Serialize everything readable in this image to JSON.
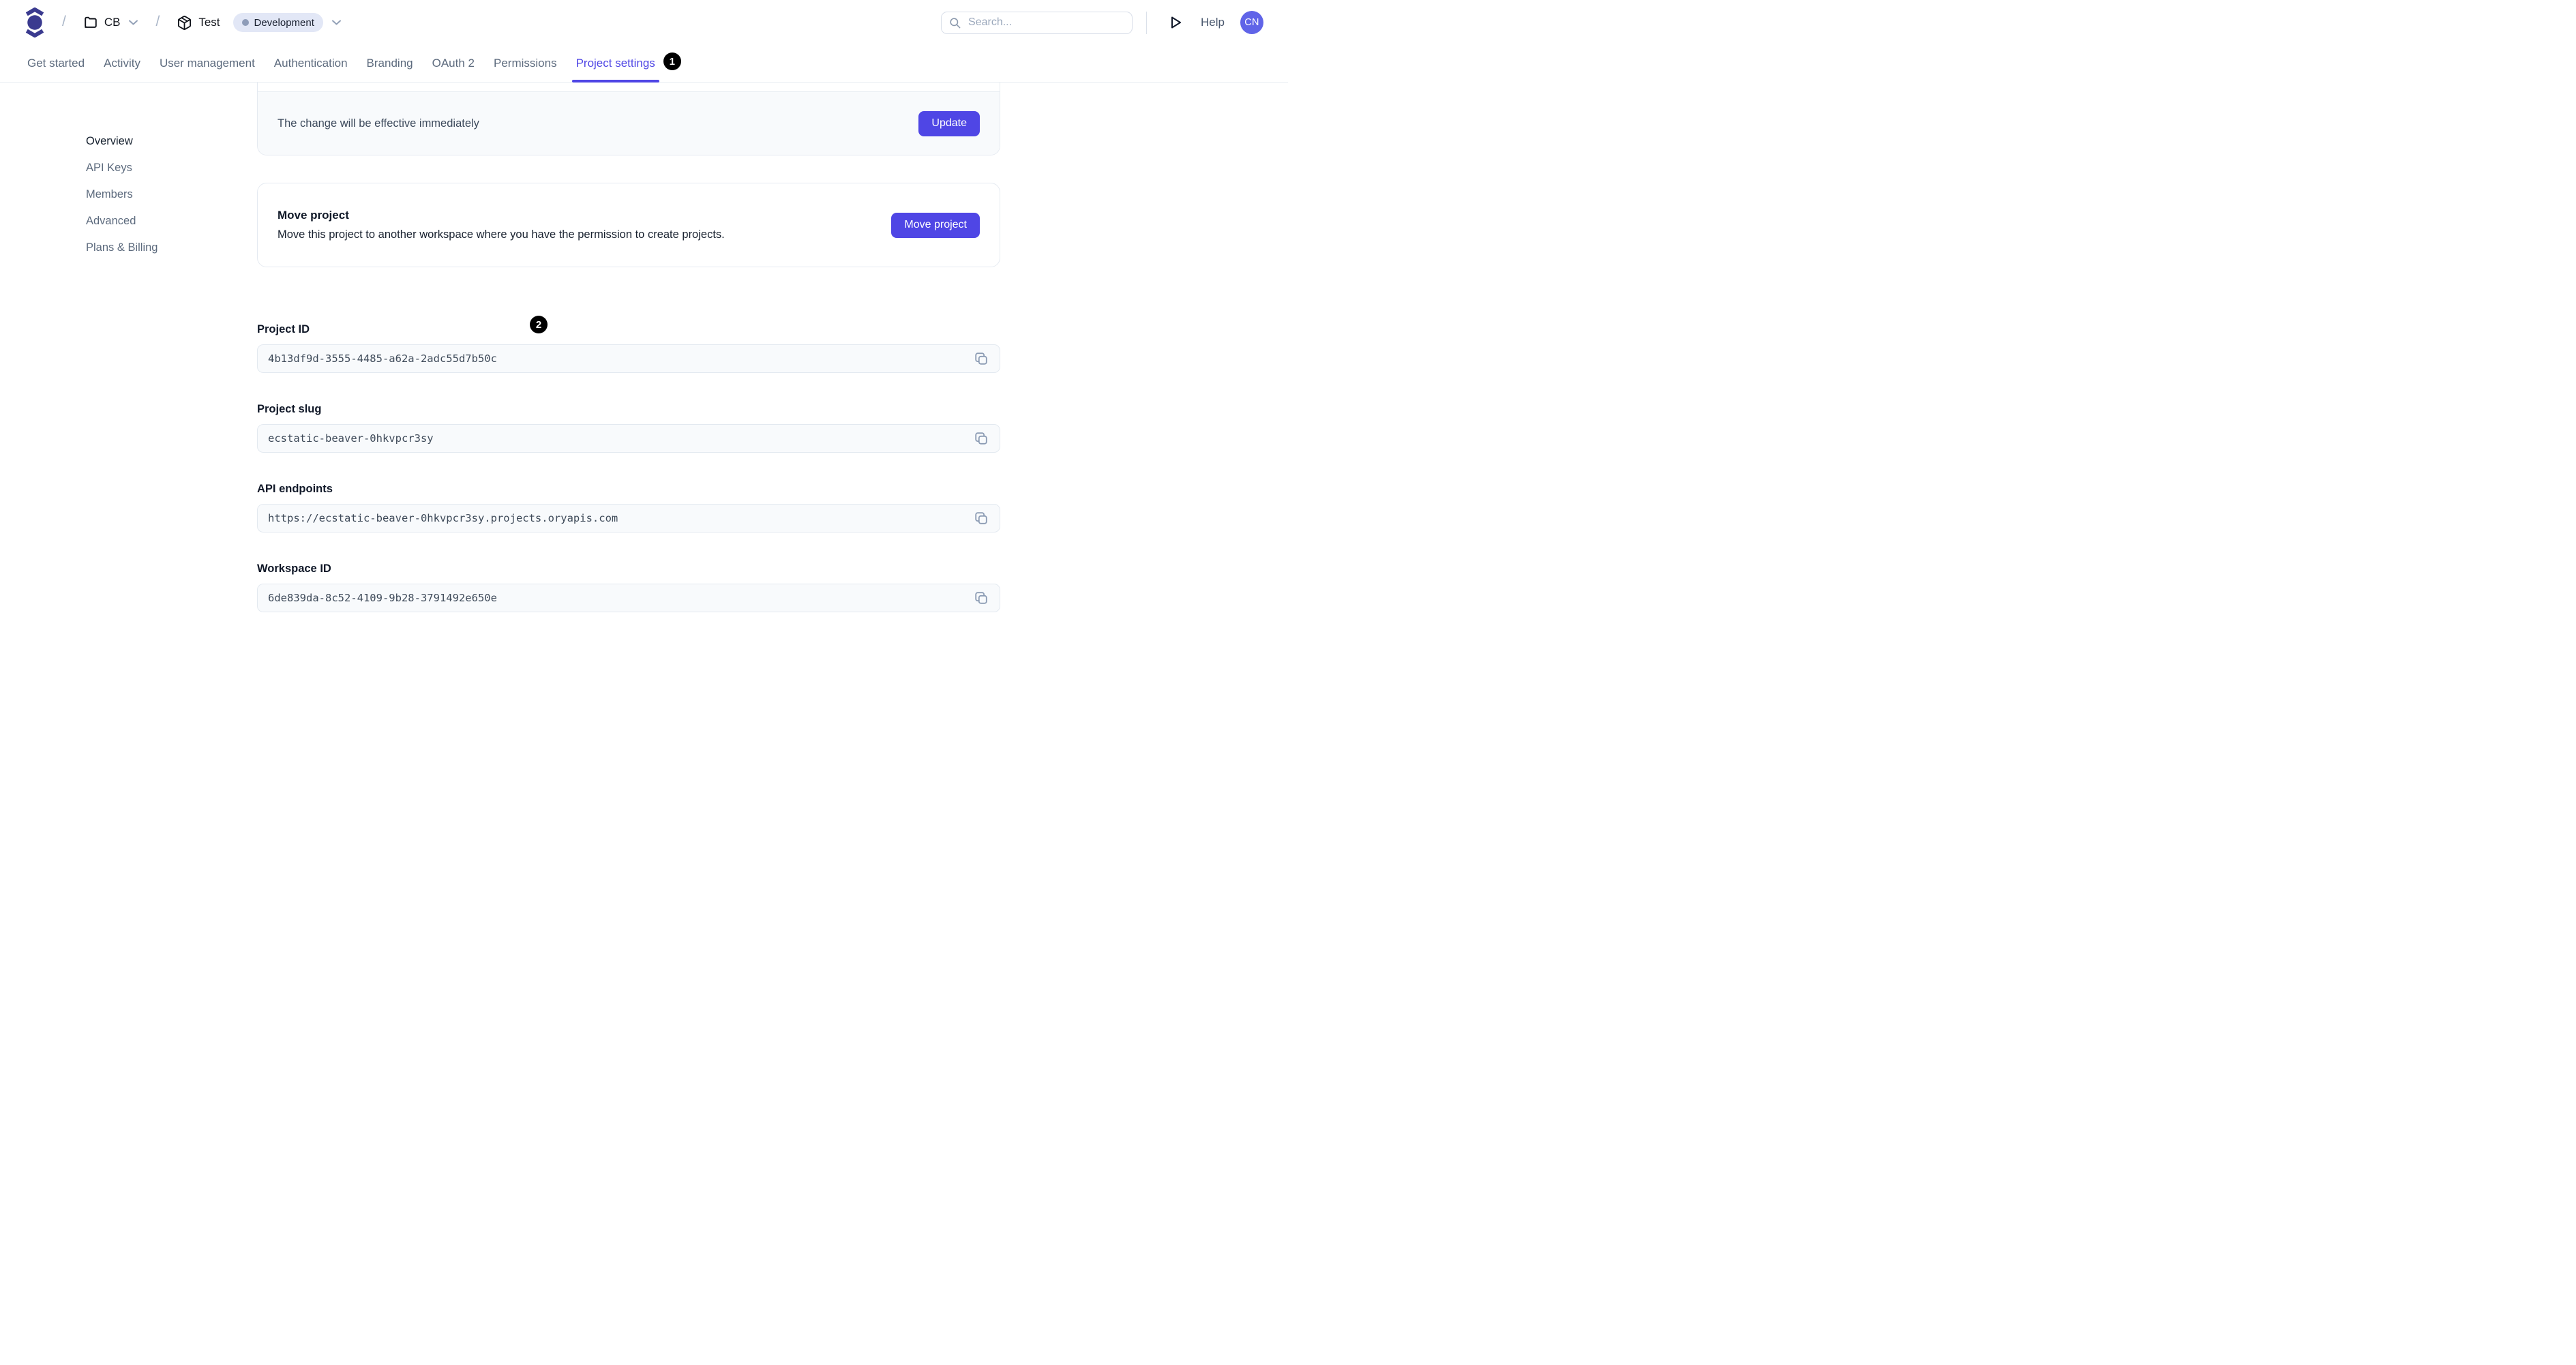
{
  "header": {
    "breadcrumb": {
      "workspace": "CB",
      "project": "Test",
      "environment": "Development",
      "separator": "/"
    },
    "search": {
      "placeholder": "Search..."
    },
    "help_label": "Help",
    "avatar_initials": "CN"
  },
  "icons": {
    "logo": "ory-spinning-top-icon",
    "workspace": "folder-icon",
    "project": "package-icon",
    "breadcrumb_expand": "chevron-down-icon",
    "search": "search-icon",
    "shortcut": "play-icon",
    "copy": "copy-icon"
  },
  "tabs": [
    {
      "label": "Get started",
      "active": false
    },
    {
      "label": "Activity",
      "active": false
    },
    {
      "label": "User management",
      "active": false
    },
    {
      "label": "Authentication",
      "active": false
    },
    {
      "label": "Branding",
      "active": false
    },
    {
      "label": "OAuth 2",
      "active": false
    },
    {
      "label": "Permissions",
      "active": false
    },
    {
      "label": "Project settings",
      "active": true
    }
  ],
  "annotations": {
    "marker_1": "1",
    "marker_2": "2"
  },
  "sidebar": {
    "items": [
      {
        "label": "Overview",
        "active": true
      },
      {
        "label": "API Keys",
        "active": false
      },
      {
        "label": "Members",
        "active": false
      },
      {
        "label": "Advanced",
        "active": false
      },
      {
        "label": "Plans & Billing",
        "active": false
      }
    ]
  },
  "main": {
    "update_card": {
      "message": "The change will be effective immediately",
      "button_label": "Update"
    },
    "move_card": {
      "title": "Move project",
      "description": "Move this project to another workspace where you have the permission to create projects.",
      "button_label": "Move project"
    },
    "fields": [
      {
        "label": "Project ID",
        "value": "4b13df9d-3555-4485-a62a-2adc55d7b50c"
      },
      {
        "label": "Project slug",
        "value": "ecstatic-beaver-0hkvpcr3sy"
      },
      {
        "label": "API endpoints",
        "value": "https://ecstatic-beaver-0hkvpcr3sy.projects.oryapis.com"
      },
      {
        "label": "Workspace ID",
        "value": "6de839da-8c52-4109-9b28-3791492e650e"
      }
    ]
  },
  "colors": {
    "accent": "#4f46e5",
    "logo": "#3a3a8f",
    "avatar_bg": "#6064e8",
    "env_badge_bg": "#e2e7f6",
    "env_badge_dot": "#8e9cb8",
    "field_bg": "#f8fafc",
    "card_border": "#e5eaf1",
    "marker_bg": "#000000"
  }
}
